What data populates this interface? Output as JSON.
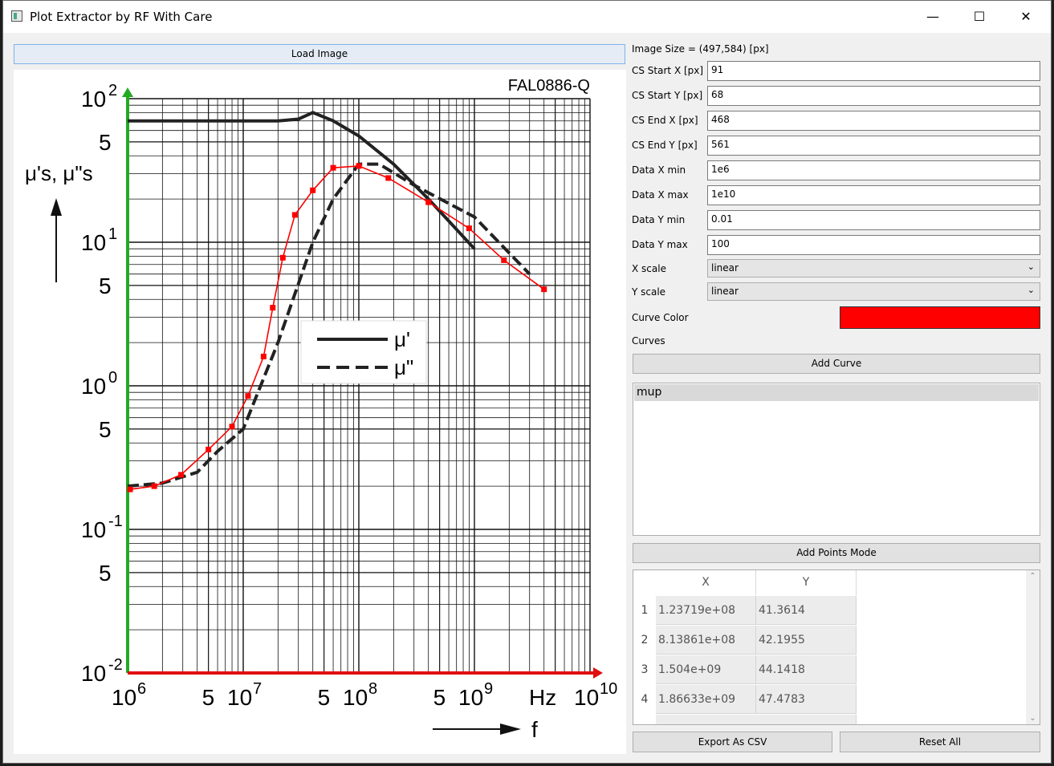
{
  "window": {
    "title": "Plot Extractor by RF With Care",
    "minimize": "—",
    "maximize": "☐",
    "close": "✕"
  },
  "load_button": "Load Image",
  "image": {
    "logo": "FAL0886-Q",
    "y_axis_label": "μ's, μ\"s",
    "legend": [
      "μ'",
      "μ\""
    ],
    "x_ticks": [
      "10",
      "5",
      "10",
      "5",
      "10",
      "5",
      "10",
      "Hz",
      "10"
    ],
    "x_exps": [
      "6",
      "7",
      "8",
      "9",
      "10"
    ],
    "y_ticks": [
      "10",
      "5",
      "10",
      "5",
      "10",
      "5",
      "10",
      "5",
      "10"
    ],
    "y_exps": [
      "2",
      "1",
      "0",
      "-1",
      "-2"
    ],
    "f_label": "f"
  },
  "chart_data": {
    "type": "line",
    "title": "FAL0886-Q",
    "x_scale": "log",
    "y_scale": "log",
    "xlim": [
      1000000,
      10000000000
    ],
    "ylim": [
      0.01,
      100
    ],
    "series": [
      {
        "name": "μ'",
        "color": "#222222",
        "style": "solid",
        "points": [
          [
            1000000,
            70
          ],
          [
            5000000,
            70
          ],
          [
            20000000,
            70
          ],
          [
            30000000,
            72
          ],
          [
            40000000,
            80
          ],
          [
            60000000,
            70
          ],
          [
            100000000,
            55
          ],
          [
            200000000,
            35
          ],
          [
            400000000,
            20
          ],
          [
            1000000000,
            9
          ]
        ]
      },
      {
        "name": "μ\"",
        "color": "#222222",
        "style": "dashed",
        "points": [
          [
            1000000,
            0.2
          ],
          [
            2000000,
            0.21
          ],
          [
            4000000,
            0.25
          ],
          [
            6000000,
            0.35
          ],
          [
            10000000,
            0.5
          ],
          [
            20000000,
            2
          ],
          [
            40000000,
            10
          ],
          [
            60000000,
            20
          ],
          [
            100000000,
            35
          ],
          [
            150000000,
            35
          ],
          [
            300000000,
            25
          ],
          [
            1000000000,
            15
          ],
          [
            3000000000,
            6
          ]
        ]
      },
      {
        "name": "mup",
        "color": "#ff0000",
        "style": "extracted",
        "points": [
          [
            1050000,
            0.19
          ],
          [
            1700000,
            0.2
          ],
          [
            2900000,
            0.24
          ],
          [
            5000000,
            0.36
          ],
          [
            8000000,
            0.52
          ],
          [
            11000000,
            0.85
          ],
          [
            15000000,
            1.6
          ],
          [
            18000000,
            3.5
          ],
          [
            22000000,
            7.8
          ],
          [
            28000000,
            15.5
          ],
          [
            40000000,
            23
          ],
          [
            60000000,
            33
          ],
          [
            100000000,
            34
          ],
          [
            180000000,
            28
          ],
          [
            400000000,
            19
          ],
          [
            900000000,
            12.5
          ],
          [
            1800000000,
            7.5
          ],
          [
            4000000000,
            4.7
          ]
        ]
      }
    ]
  },
  "panel": {
    "image_size": "Image Size = (497,584) [px]",
    "fields": [
      {
        "label": "CS Start X [px]",
        "value": "91"
      },
      {
        "label": "CS Start Y [px]",
        "value": "68"
      },
      {
        "label": "CS End X [px]",
        "value": "468"
      },
      {
        "label": "CS End Y [px]",
        "value": "561"
      },
      {
        "label": "Data X min",
        "value": "1e6"
      },
      {
        "label": "Data X max",
        "value": "1e10"
      },
      {
        "label": "Data Y min",
        "value": "0.01"
      },
      {
        "label": "Data Y max",
        "value": "100"
      }
    ],
    "x_scale_label": "X scale",
    "x_scale_value": "linear",
    "y_scale_label": "Y scale",
    "y_scale_value": "linear",
    "curve_color_label": "Curve Color",
    "curve_color": "#ff0000",
    "curves_label": "Curves",
    "add_curve": "Add Curve",
    "curves": [
      "mup"
    ],
    "add_points": "Add Points Mode",
    "table": {
      "headers": [
        "X",
        "Y"
      ],
      "rows": [
        {
          "n": "1",
          "x": "1.23719e+08",
          "y": "41.3614"
        },
        {
          "n": "2",
          "x": "8.13861e+08",
          "y": "42.1955"
        },
        {
          "n": "3",
          "x": "1.504e+09",
          "y": "44.1418"
        },
        {
          "n": "4",
          "x": "1.86633e+09",
          "y": "47.4783"
        }
      ]
    },
    "export": "Export As CSV",
    "reset": "Reset All"
  }
}
